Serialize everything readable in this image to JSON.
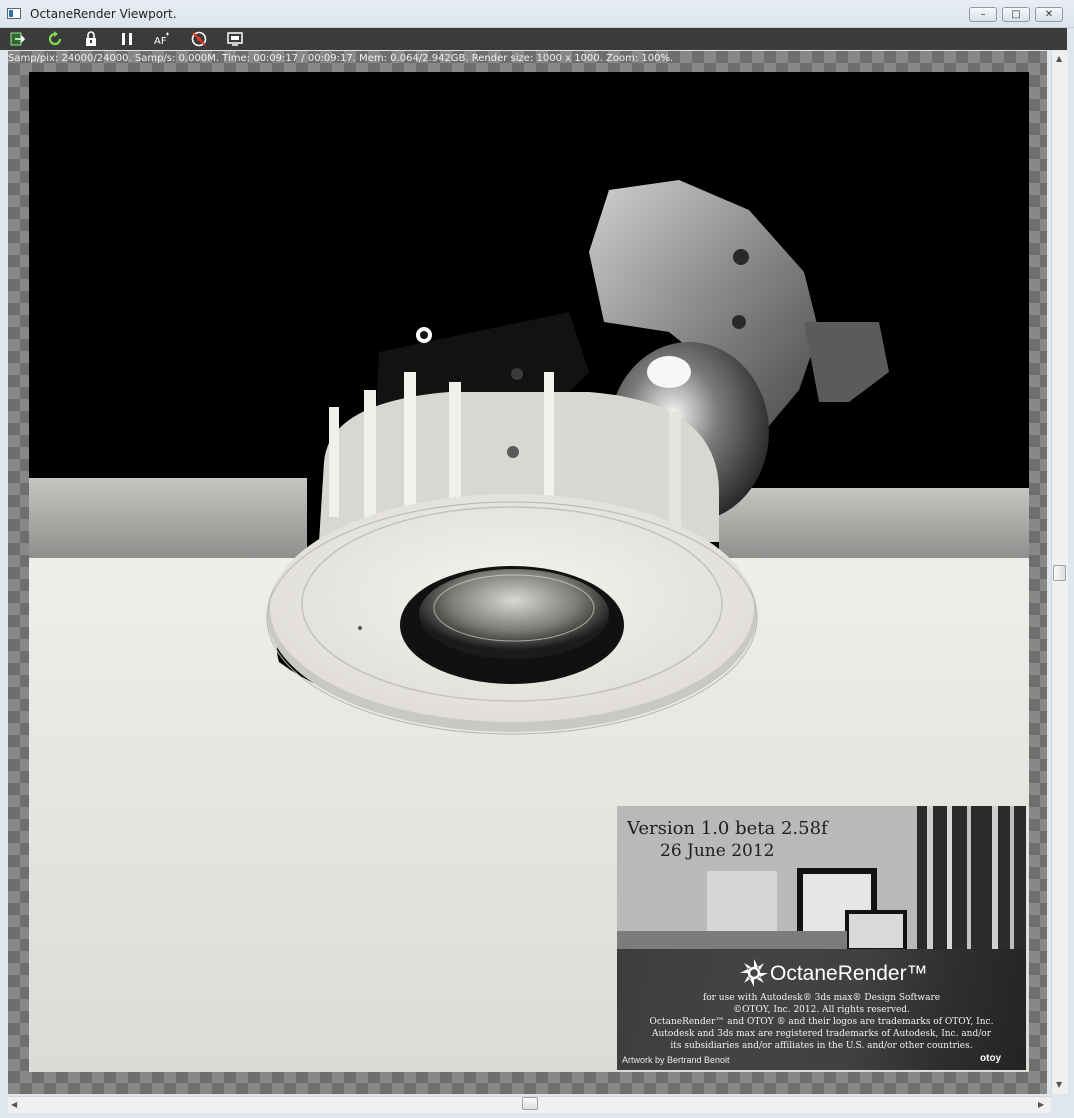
{
  "window": {
    "title": "OctaneRender Viewport.",
    "controls": [
      "minimize",
      "maximize",
      "close"
    ]
  },
  "toolbar": {
    "buttons": [
      {
        "icon": "send-to-octane-icon"
      },
      {
        "icon": "restart-render-icon"
      },
      {
        "icon": "lock-icon"
      },
      {
        "icon": "pause-icon"
      },
      {
        "icon": "autofocus-icon"
      },
      {
        "icon": "pick-focus-icon"
      },
      {
        "icon": "region-render-icon"
      }
    ]
  },
  "status": {
    "text": "Samp/pix: 24000/24000.   Samp/s: 0.000M.   Time: 00:09:17 / 00:09:17.   Mem: 0.064/2.942GB.   Render size: 1000 x 1000.   Zoom: 100%."
  },
  "splash": {
    "version": "Version 1.0 beta 2.58f",
    "date": "26 June 2012",
    "brand_bold": "Octane",
    "brand_rest": "Render™",
    "lines": [
      "for use with Autodesk® 3ds max® Design Software",
      "©OTOY, Inc. 2012. All rights reserved.",
      "OctaneRender™ and OTOY ® and their logos are trademarks of OTOY, Inc.",
      "Autodesk and 3ds max are registered trademarks of Autodesk, Inc. and/or",
      "its subsidiaries and/or affiliates in the U.S. and/or other countries."
    ],
    "artwork": "Artwork by Bertrand Benoit",
    "otoy": "otoy"
  },
  "colors": {
    "toolbar_bg": "#3b3b3b",
    "ceiling": "#e2e1dc",
    "fixture": "#ecebe6"
  }
}
